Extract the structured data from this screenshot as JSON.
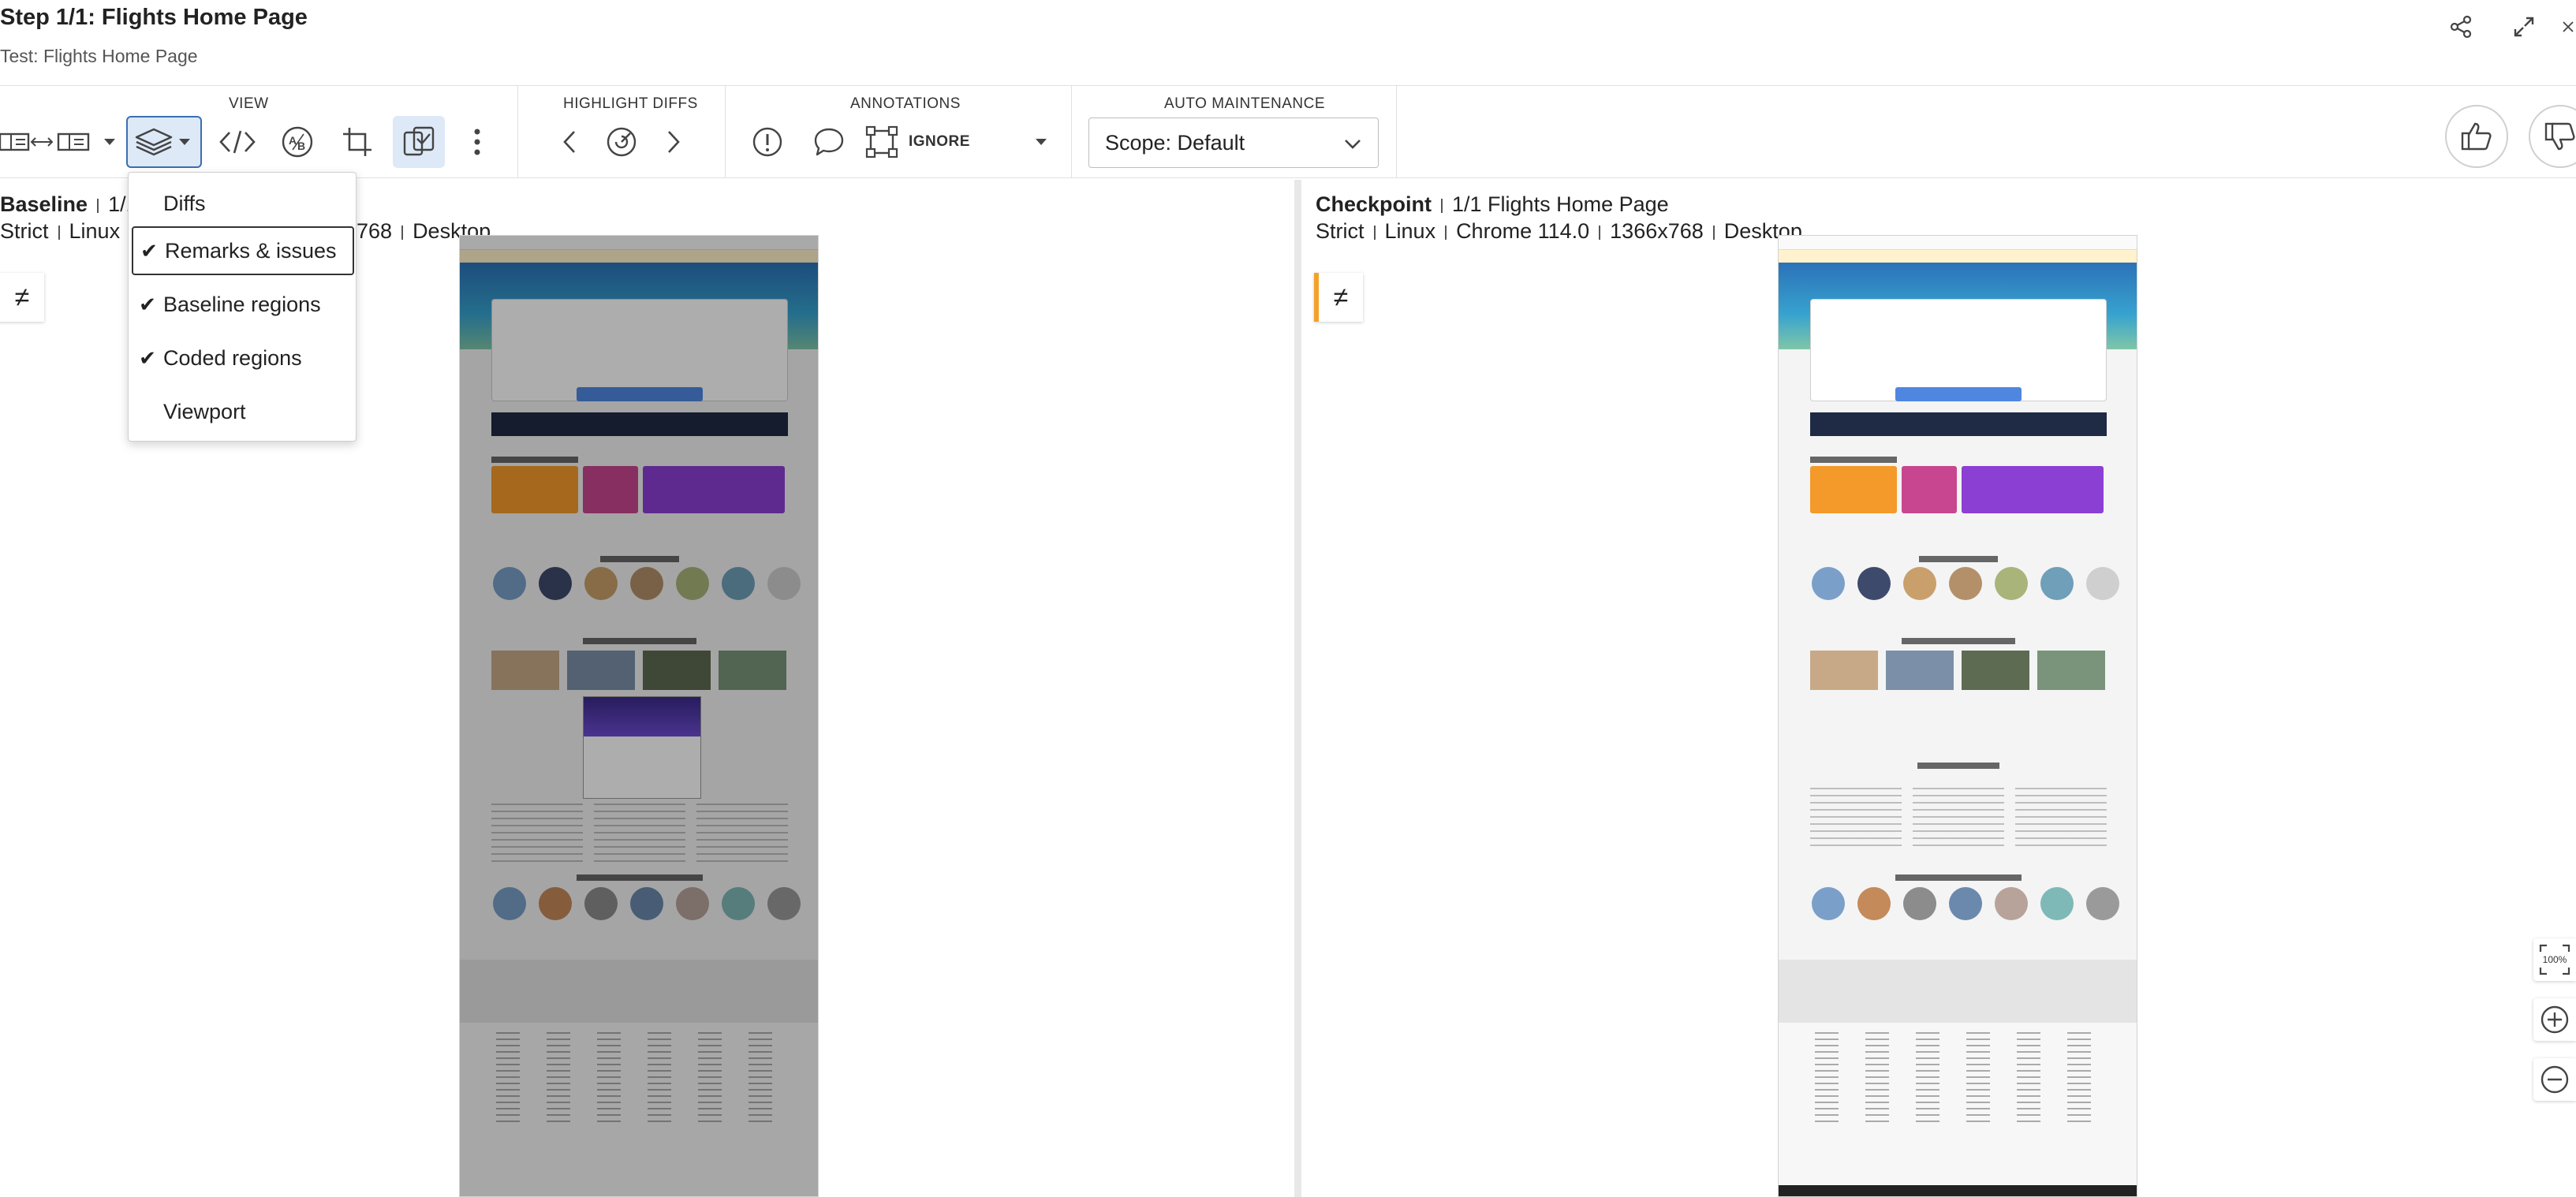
{
  "header": {
    "step_prefix": "Step 1/1:",
    "step_name": "Flights Home Page",
    "test_label": "Test: Flights Home Page"
  },
  "toolbar": {
    "view_label": "VIEW",
    "highlight_label": "HIGHLIGHT DIFFS",
    "annotations_label": "ANNOTATIONS",
    "auto_label": "AUTO MAINTENANCE",
    "ignore_label": "IGNORE",
    "scope_value": "Scope: Default"
  },
  "menu": {
    "items": [
      {
        "label": "Diffs",
        "checked": false
      },
      {
        "label": "Remarks & issues",
        "checked": true
      },
      {
        "label": "Baseline regions",
        "checked": true
      },
      {
        "label": "Coded regions",
        "checked": true
      },
      {
        "label": "Viewport",
        "checked": false
      }
    ],
    "check_glyph": "✔"
  },
  "baseline": {
    "title": "Baseline",
    "step": "1/1",
    "match": "Strict",
    "os": "Linux",
    "resolution_tail": "768",
    "device": "Desktop"
  },
  "checkpoint": {
    "title": "Checkpoint",
    "step_name": "1/1 Flights Home Page",
    "match": "Strict",
    "os": "Linux",
    "browser": "Chrome 114.0",
    "resolution": "1366x768",
    "device": "Desktop"
  },
  "badge_glyph": "≠",
  "zoom": {
    "fit_label": "100%"
  },
  "colors": {
    "accent_orange": "#f4a12a",
    "active_blue": "#3a6fb0",
    "active_bg": "#dde9f7"
  }
}
